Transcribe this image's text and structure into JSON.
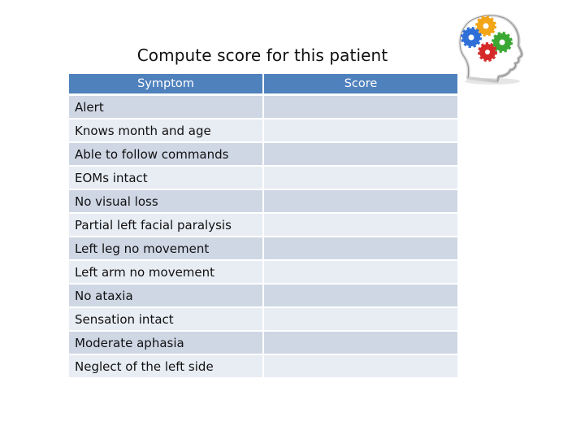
{
  "slide": {
    "title": "Compute score for this patient",
    "image": "head-with-gears-icon"
  },
  "table": {
    "columns": [
      "Symptom",
      "Score"
    ],
    "rows": [
      {
        "symptom": "Alert",
        "score": ""
      },
      {
        "symptom": "Knows month and age",
        "score": ""
      },
      {
        "symptom": "Able to follow commands",
        "score": ""
      },
      {
        "symptom": "EOMs intact",
        "score": ""
      },
      {
        "symptom": "No visual loss",
        "score": ""
      },
      {
        "symptom": "Partial left facial paralysis",
        "score": ""
      },
      {
        "symptom": "Left leg no movement",
        "score": ""
      },
      {
        "symptom": "Left arm no movement",
        "score": ""
      },
      {
        "symptom": "No ataxia",
        "score": ""
      },
      {
        "symptom": "Sensation intact",
        "score": ""
      },
      {
        "symptom": "Moderate aphasia",
        "score": ""
      },
      {
        "symptom": "Neglect of the left side",
        "score": ""
      }
    ]
  },
  "colors": {
    "header": "#4f81bd",
    "row_dark": "#cfd7e5",
    "row_light": "#e8ecf3",
    "gear_blue": "#2f6fd8",
    "gear_orange": "#f2a516",
    "gear_green": "#3aa832",
    "gear_red": "#d62a2a"
  }
}
